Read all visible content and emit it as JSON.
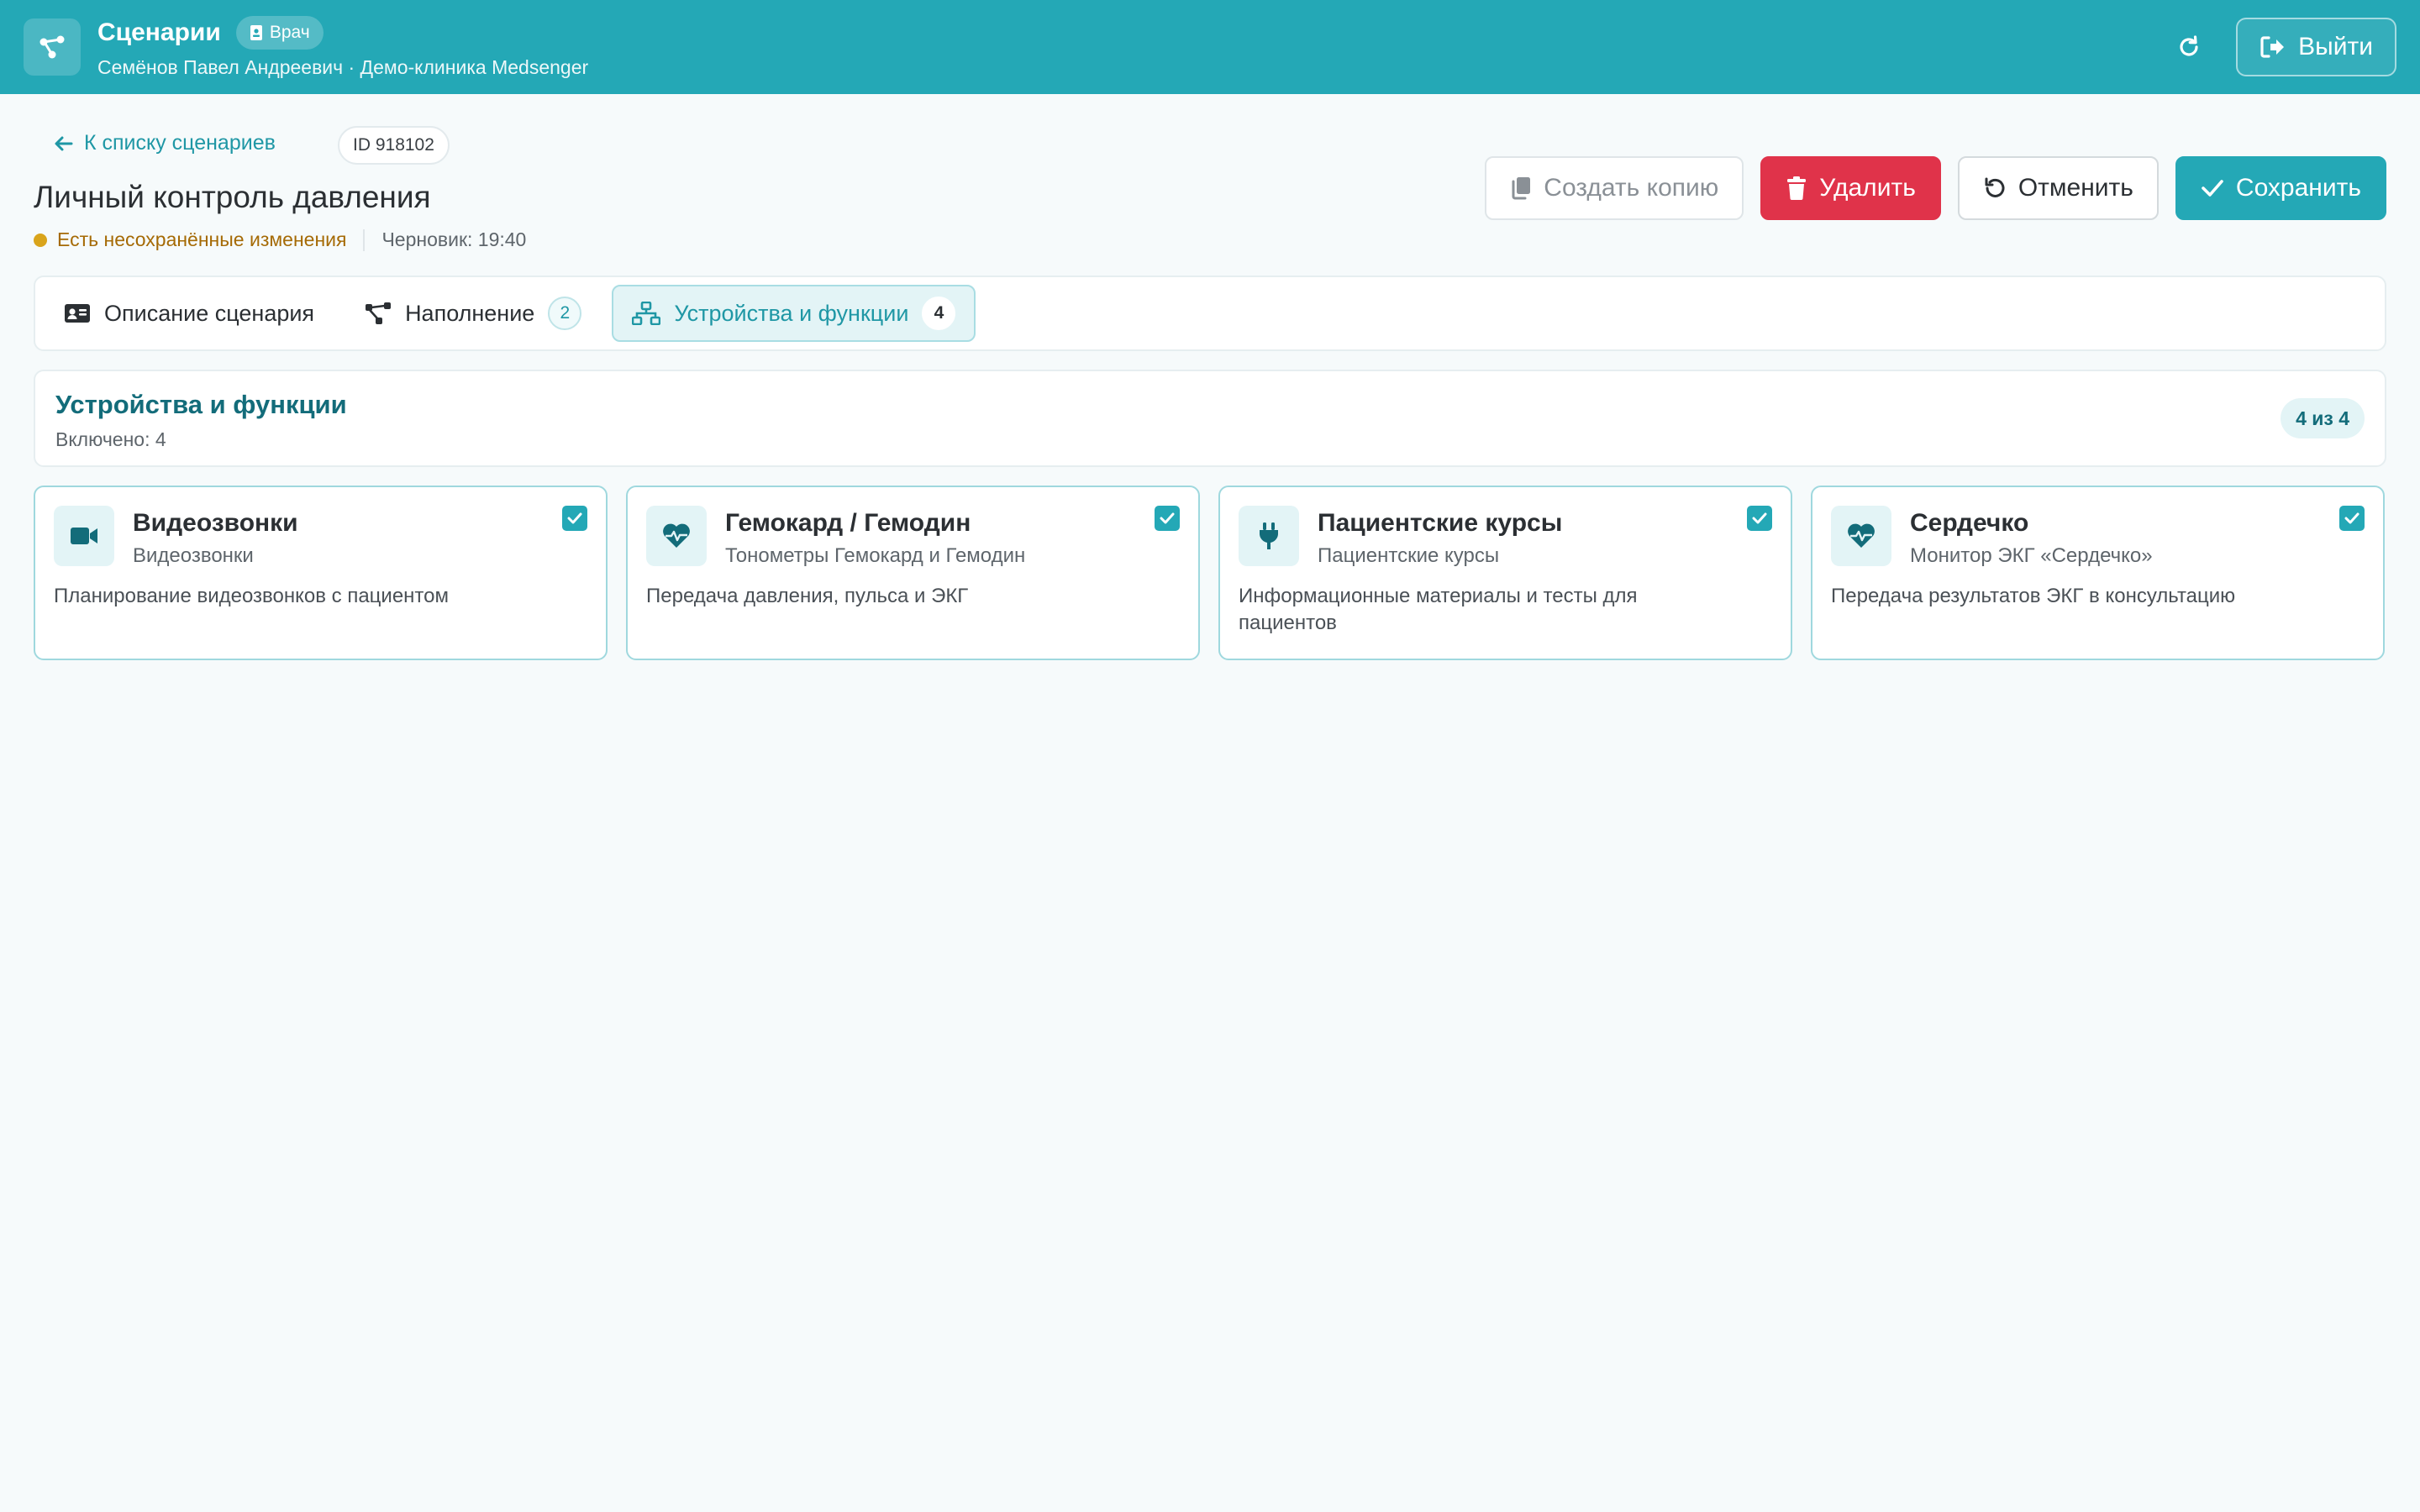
{
  "header": {
    "title": "Сценарии",
    "role_badge": "Врач",
    "subtitle": "Семёнов Павел Андреевич · Демо-клиника Medsenger",
    "logout_label": "Выйти"
  },
  "page": {
    "back_label": "К списку сценариев",
    "id_badge": "ID 918102",
    "title": "Личный контроль давления",
    "unsaved_text": "Есть несохранённые изменения",
    "draft_text": "Черновик: 19:40"
  },
  "actions": {
    "copy_label": "Создать копию",
    "delete_label": "Удалить",
    "cancel_label": "Отменить",
    "save_label": "Сохранить"
  },
  "tabs": [
    {
      "label": "Описание сценария",
      "count": null
    },
    {
      "label": "Наполнение",
      "count": "2"
    },
    {
      "label": "Устройства и функции",
      "count": "4"
    }
  ],
  "section": {
    "title": "Устройства и функции",
    "subtitle": "Включено: 4",
    "counter": "4 из 4"
  },
  "cards": [
    {
      "title": "Видеозвонки",
      "subtitle": "Видеозвонки",
      "description": "Планирование видеозвонков с пациентом",
      "icon": "video-icon"
    },
    {
      "title": "Гемокард / Гемодин",
      "subtitle": "Тонометры Гемокард и Гемодин",
      "description": "Передача давления, пульса и ЭКГ",
      "icon": "heart-pulse-icon"
    },
    {
      "title": "Пациентские курсы",
      "subtitle": "Пациентские курсы",
      "description": "Информационные материалы и тесты для пациентов",
      "icon": "plug-icon"
    },
    {
      "title": "Сердечко",
      "subtitle": "Монитор ЭКГ «Сердечко»",
      "description": "Передача результатов ЭКГ в консультацию",
      "icon": "heart-pulse-icon"
    }
  ],
  "colors": {
    "brand": "#24a8b6",
    "danger": "#e0334a",
    "warning_dot": "#d9a41b",
    "section_title": "#136c7a"
  }
}
